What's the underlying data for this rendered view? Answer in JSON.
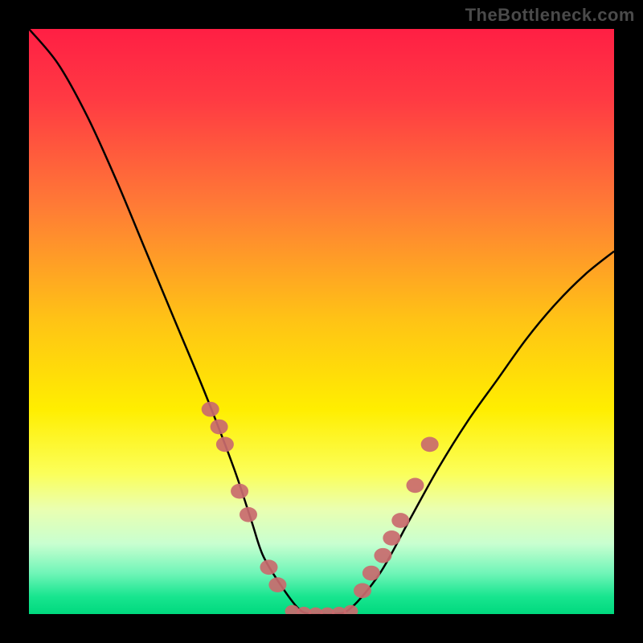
{
  "watermark": "TheBottleneck.com",
  "chart_data": {
    "type": "line",
    "title": "",
    "xlabel": "",
    "ylabel": "",
    "xlim": [
      0,
      100
    ],
    "ylim": [
      0,
      100
    ],
    "curve": {
      "x": [
        0,
        5,
        10,
        15,
        20,
        25,
        30,
        35,
        38,
        40,
        43,
        46,
        48,
        50,
        52,
        55,
        60,
        65,
        70,
        75,
        80,
        85,
        90,
        95,
        100
      ],
      "y": [
        100,
        94,
        85,
        74,
        62,
        50,
        38,
        25,
        16,
        10,
        5,
        1,
        0,
        0,
        0,
        1,
        7,
        16,
        25,
        33,
        40,
        47,
        53,
        58,
        62
      ]
    },
    "left_markers": {
      "x": [
        31,
        32.5,
        33.5,
        36,
        37.5,
        41,
        42.5
      ],
      "y": [
        35,
        32,
        29,
        21,
        17,
        8,
        5
      ]
    },
    "right_markers": {
      "x": [
        57,
        58.5,
        60.5,
        62,
        63.5,
        66,
        68.5
      ],
      "y": [
        4,
        7,
        10,
        13,
        16,
        22,
        29
      ]
    },
    "bottom_markers": {
      "x": [
        45,
        47,
        49,
        51,
        53,
        55
      ],
      "y": [
        0.5,
        0.2,
        0.1,
        0.1,
        0.2,
        0.5
      ]
    },
    "marker_color": "#c96a6e",
    "curve_color": "#000000",
    "gradient_stops": [
      {
        "offset": 0.0,
        "color": "#ff1f44"
      },
      {
        "offset": 0.12,
        "color": "#ff3a43"
      },
      {
        "offset": 0.3,
        "color": "#ff7a36"
      },
      {
        "offset": 0.5,
        "color": "#ffc415"
      },
      {
        "offset": 0.65,
        "color": "#ffee00"
      },
      {
        "offset": 0.76,
        "color": "#fbff5a"
      },
      {
        "offset": 0.82,
        "color": "#eaffb0"
      },
      {
        "offset": 0.88,
        "color": "#c8ffd0"
      },
      {
        "offset": 0.93,
        "color": "#70f5b8"
      },
      {
        "offset": 0.97,
        "color": "#18e58f"
      },
      {
        "offset": 1.0,
        "color": "#00d97e"
      }
    ]
  }
}
